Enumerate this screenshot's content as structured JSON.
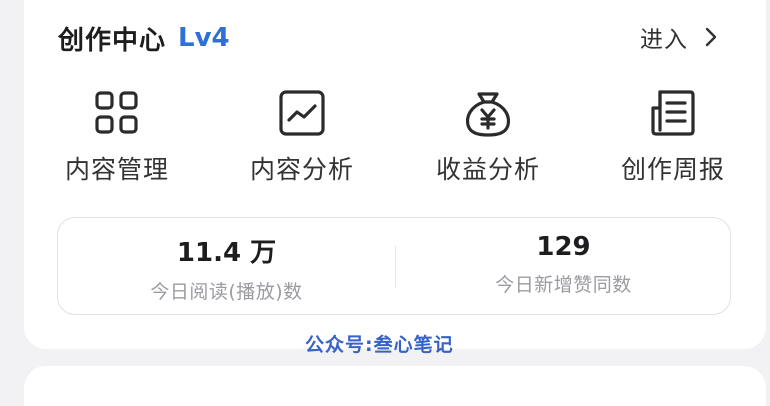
{
  "header": {
    "title": "创作中心",
    "level": "Lv4",
    "enter_label": "进入"
  },
  "tools": [
    {
      "label": "内容管理",
      "icon": "grid-icon"
    },
    {
      "label": "内容分析",
      "icon": "trend-chart-icon"
    },
    {
      "label": "收益分析",
      "icon": "money-bag-icon"
    },
    {
      "label": "创作周报",
      "icon": "report-icon"
    }
  ],
  "stats": [
    {
      "value": "11.4 万",
      "label": "今日阅读(播放)数"
    },
    {
      "value": "129",
      "label": "今日新增赞同数"
    }
  ],
  "watermark": "公众号:叁心笔记",
  "colors": {
    "accent": "#2f6fd8",
    "watermark": "#3762c8",
    "muted": "#9b9ba1"
  }
}
